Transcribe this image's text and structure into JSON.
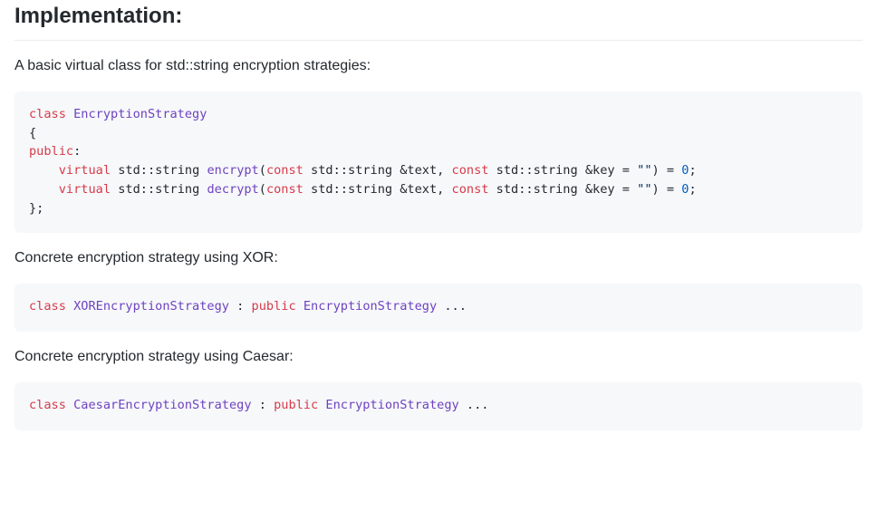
{
  "heading": "Implementation:",
  "intro": "A basic virtual class for std::string encryption strategies:",
  "code1": {
    "kw_class": "class",
    "cls_name": "EncryptionStrategy",
    "brace_open": "{",
    "kw_public": "public",
    "colon": ":",
    "indent": "    ",
    "kw_virtual": "virtual",
    "std_string": " std::string ",
    "fn_encrypt": "encrypt",
    "fn_decrypt": "decrypt",
    "paren_open": "(",
    "kw_const": "const",
    "param1": " std::string &text, ",
    "param2": " std::string &key = ",
    "str_empty": "\"\"",
    "tail": ") = ",
    "zero": "0",
    "semi": ";",
    "brace_close": "};"
  },
  "para_xor": "Concrete encryption strategy using XOR:",
  "code2": {
    "kw_class": "class",
    "cls_name": "XOREncryptionStrategy",
    "between": " : ",
    "kw_public": "public",
    "space": " ",
    "base_name": "EncryptionStrategy",
    "tail": " ..."
  },
  "para_caesar": "Concrete encryption strategy using Caesar:",
  "code3": {
    "kw_class": "class",
    "cls_name": "CaesarEncryptionStrategy",
    "between": " : ",
    "kw_public": "public",
    "space": " ",
    "base_name": "EncryptionStrategy",
    "tail": " ..."
  }
}
